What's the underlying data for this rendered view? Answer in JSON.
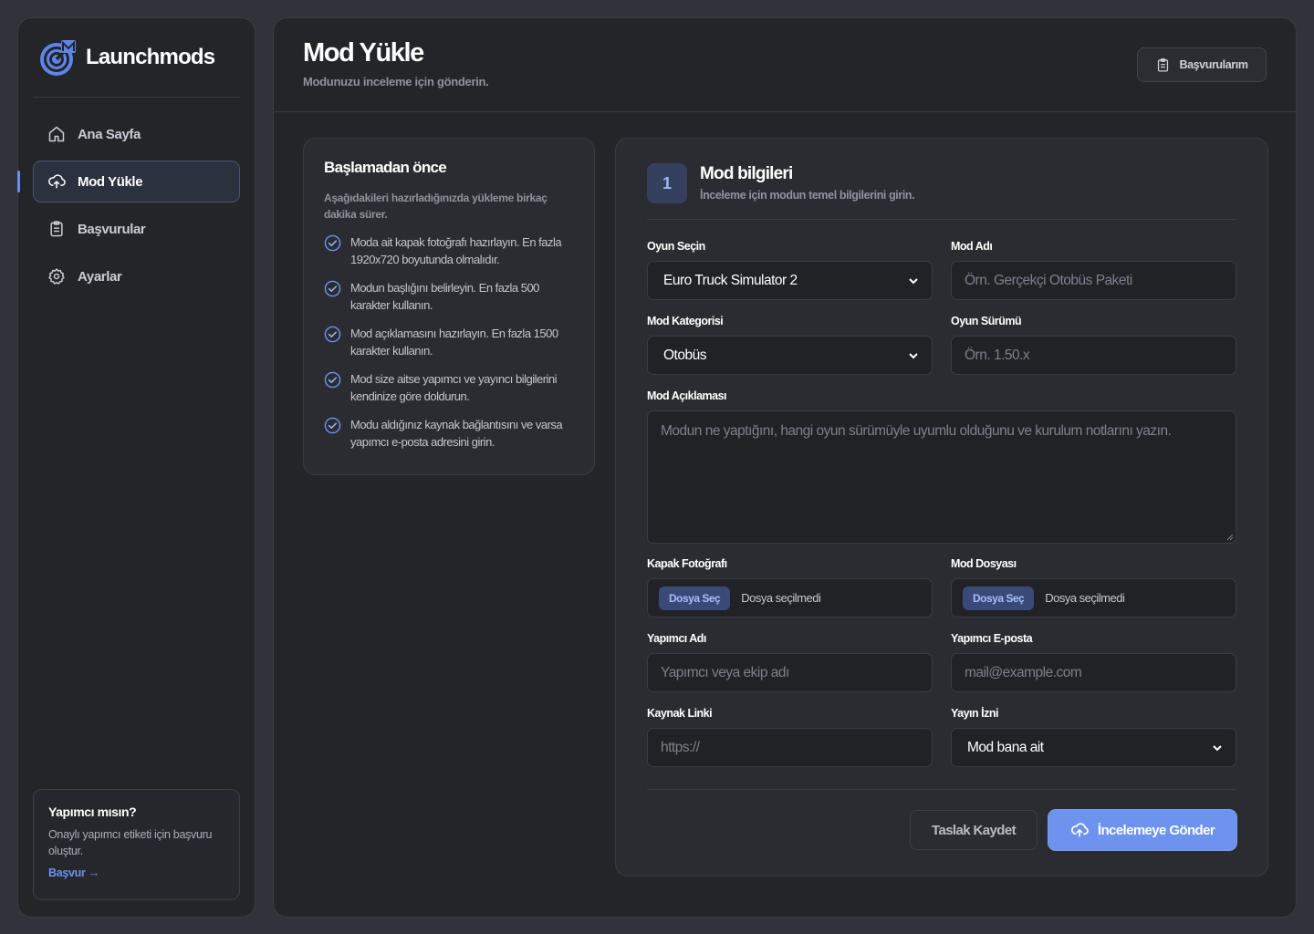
{
  "brand": {
    "name": "Launchmods"
  },
  "sidebar": {
    "items": [
      {
        "label": "Ana Sayfa",
        "icon": "home-icon",
        "active": false
      },
      {
        "label": "Mod Yükle",
        "icon": "cloud-upload-icon",
        "active": true
      },
      {
        "label": "Başvurular",
        "icon": "clipboard-icon",
        "active": false
      },
      {
        "label": "Ayarlar",
        "icon": "gear-icon",
        "active": false
      }
    ],
    "promo": {
      "title": "Yapımcı mısın?",
      "description": "Onaylı yapımcı etiketi için başvuru oluştur.",
      "link": "Başvur →"
    }
  },
  "header": {
    "title": "Mod Yükle",
    "subtitle": "Modunuzu inceleme için gönderin.",
    "applications_button": "Başvurularım"
  },
  "info": {
    "title": "Başlamadan önce",
    "description": "Aşağıdakileri hazırladığınızda yükleme birkaç dakika sürer.",
    "checklist": [
      "Moda ait kapak fotoğrafı hazırlayın. En fazla 1920x720 boyutunda olmalıdır.",
      "Modun başlığını belirleyin. En fazla 500 karakter kullanın.",
      "Mod açıklamasını hazırlayın. En fazla 1500 karakter kullanın.",
      "Mod size aitse yapımcı ve yayıncı bilgilerini kendinize göre doldurun.",
      "Modu aldığınız kaynak bağlantısını ve varsa yapımcı e-posta adresini girin."
    ]
  },
  "form": {
    "step": "1",
    "title": "Mod bilgileri",
    "subtitle": "İnceleme için modun temel bilgilerini girin.",
    "game": {
      "label": "Oyun Seçin",
      "value": "Euro Truck Simulator 2"
    },
    "mod_name": {
      "label": "Mod Adı",
      "placeholder": "Örn. Gerçekçi Otobüs Paketi"
    },
    "category": {
      "label": "Mod Kategorisi",
      "value": "Otobüs"
    },
    "game_version": {
      "label": "Oyun Sürümü",
      "placeholder": "Örn. 1.50.x"
    },
    "description": {
      "label": "Mod Açıklaması",
      "placeholder": "Modun ne yaptığını, hangi oyun sürümüyle uyumlu olduğunu ve kurulum notlarını yazın."
    },
    "cover": {
      "label": "Kapak Fotoğrafı",
      "button": "Dosya Seç",
      "status": "Dosya seçilmedi"
    },
    "mod_file": {
      "label": "Mod Dosyası",
      "button": "Dosya Seç",
      "status": "Dosya seçilmedi"
    },
    "author_name": {
      "label": "Yapımcı Adı",
      "placeholder": "Yapımcı veya ekip adı"
    },
    "author_email": {
      "label": "Yapımcı E-posta",
      "placeholder": "mail@example.com"
    },
    "source_link": {
      "label": "Kaynak Linki",
      "placeholder": "https://"
    },
    "permission": {
      "label": "Yayın İzni",
      "value": "Mod bana ait"
    },
    "draft_button": "Taslak Kaydet",
    "submit_button": "İncelemeye Gönder"
  },
  "colors": {
    "accent": "#6e93ef",
    "panel": "#232529",
    "background": "#30333a"
  }
}
